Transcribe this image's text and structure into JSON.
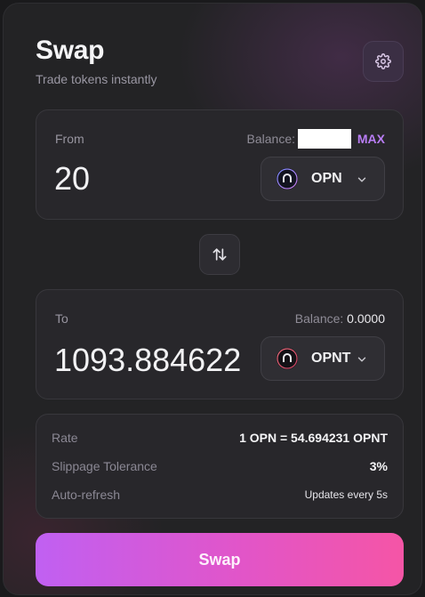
{
  "header": {
    "title": "Swap",
    "subtitle": "Trade tokens instantly"
  },
  "from": {
    "label": "From",
    "balance_label": "Balance:",
    "max_label": "MAX",
    "amount": "20",
    "token": "OPN",
    "token_icon": "opn-logo-icon"
  },
  "to": {
    "label": "To",
    "balance_label": "Balance:",
    "balance_value": "0.0000",
    "amount": "1093.884622",
    "token": "OPNT",
    "token_icon": "opnt-logo-icon"
  },
  "info": {
    "rate_label": "Rate",
    "rate_value": "1 OPN = 54.694231 OPNT",
    "slippage_label": "Slippage Tolerance",
    "slippage_value": "3%",
    "refresh_label": "Auto-refresh",
    "refresh_value": "Updates every 5s"
  },
  "action": {
    "swap_label": "Swap"
  },
  "colors": {
    "accent": "#b97df5",
    "button_start": "#c060f2",
    "button_end": "#f555a6"
  }
}
